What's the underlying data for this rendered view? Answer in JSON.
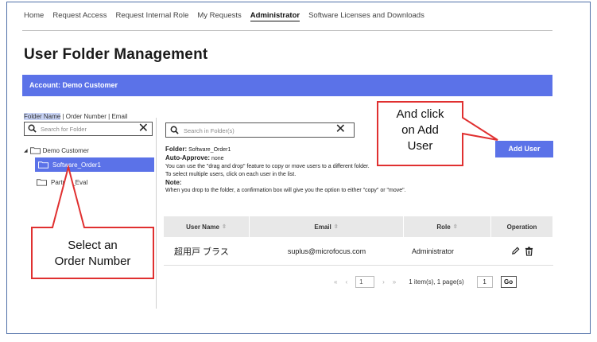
{
  "nav": {
    "items": [
      "Home",
      "Request Access",
      "Request Internal Role",
      "My Requests",
      "Administrator",
      "Software Licenses and Downloads"
    ],
    "active": "Administrator"
  },
  "page_title": "User Folder Management",
  "account_bar": "Account: Demo Customer",
  "left_panel": {
    "filter_folder_name": "Folder Name",
    "filter_sep1": " | ",
    "filter_order_number": "Order Number",
    "filter_sep2": " | ",
    "filter_email": "Email",
    "search_placeholder": "Search for Folder",
    "tree_root": "Demo Customer",
    "tree_selected": "Software_Order1",
    "tree_item2": "Partner_Eval"
  },
  "right_panel": {
    "search_placeholder": "Search in Folder(s)",
    "add_user_label": "Add User",
    "folder_label": "Folder:",
    "folder_value": "Software_Order1",
    "auto_approve_label": "Auto-Approve:",
    "auto_approve_value": "none",
    "info_line1": "You can use the \"drag and drop\" feature to copy or move users to a different folder.",
    "info_line2": "To select multiple users, click on each user in the list.",
    "note_label": "Note:",
    "note_text": "When you drop to the folder, a confirmation box will give you the option to either \"copy\" or \"move\"."
  },
  "table": {
    "headers": [
      "User Name",
      "Email",
      "Role",
      "Operation"
    ],
    "rows": [
      {
        "user_name": "超用戸 ブラス",
        "email": "suplus@microfocus.com",
        "role": "Administrator"
      }
    ]
  },
  "pagination": {
    "first": "«",
    "prev": "‹",
    "page_input": "1",
    "next": "›",
    "last": "»",
    "summary": "1 item(s), 1 page(s)",
    "goto_value": "1",
    "go_label": "Go"
  },
  "callouts": {
    "add_user": [
      "And click",
      "on Add",
      "User"
    ],
    "order_number": [
      "Select an",
      "Order Number"
    ]
  },
  "colors": {
    "accent": "#5b72e8",
    "callout_border": "#e03030",
    "frame_border": "#4f6fa8"
  },
  "icons": [
    "search-icon",
    "close-icon",
    "folder-icon",
    "collapse-icon",
    "sort-icon",
    "edit-icon",
    "delete-icon"
  ]
}
